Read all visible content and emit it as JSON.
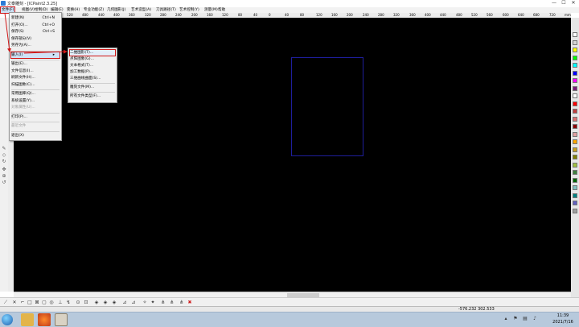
{
  "window": {
    "title": "文泰雕刻 - [ICPaint2.3.25]",
    "minimize": "—",
    "maximize": "☐",
    "close": "✕"
  },
  "menubar": [
    "文件(F)",
    "视图(V)",
    "绘制(D)",
    "编辑(E)",
    "变换(H)",
    "专业功能(Z)",
    "几何图形(J)",
    "艺术造型(A)",
    "刀具路径(T)",
    "艺术控制(Y)",
    "测量(M)",
    "帮助"
  ],
  "ruler": [
    "640",
    "600",
    "560",
    "520",
    "480",
    "440",
    "400",
    "360",
    "320",
    "280",
    "240",
    "200",
    "160",
    "120",
    "80",
    "40",
    "0",
    "40",
    "80",
    "120",
    "160",
    "200",
    "240",
    "280",
    "320",
    "360",
    "400",
    "440",
    "480",
    "520",
    "560",
    "600",
    "640",
    "680",
    "720",
    "mm"
  ],
  "file_menu": {
    "items": [
      {
        "label": "新建(N)",
        "shortcut": "Ctrl+N",
        "disabled": false
      },
      {
        "label": "打开(O)...",
        "shortcut": "Ctrl+O",
        "disabled": false
      },
      {
        "label": "保存(S)",
        "shortcut": "Ctrl+S",
        "disabled": false
      },
      {
        "label": "保存部分(V)",
        "shortcut": "",
        "disabled": false
      },
      {
        "label": "另存为(A)...",
        "shortcut": "",
        "disabled": false
      },
      {
        "label": "输入(I)",
        "shortcut": "",
        "disabled": false
      },
      {
        "label": "输出(E)...",
        "shortcut": "",
        "disabled": false
      },
      {
        "label": "文件信息(I)...",
        "shortcut": "",
        "disabled": false
      },
      {
        "label": "刷新文件(H)...",
        "shortcut": "",
        "disabled": false
      },
      {
        "label": "扫描图象(C)...",
        "shortcut": "",
        "disabled": false
      },
      {
        "label": "常用图库(Q)...",
        "shortcut": "",
        "disabled": false
      },
      {
        "label": "系统设置(Y)...",
        "shortcut": "",
        "disabled": false
      },
      {
        "label": "对象属性(U)...",
        "shortcut": "",
        "disabled": true
      },
      {
        "label": "打印(P)...",
        "shortcut": "",
        "disabled": false
      },
      {
        "label": "最近文件",
        "shortcut": "",
        "disabled": true
      },
      {
        "label": "退出(X)",
        "shortcut": "",
        "disabled": false
      }
    ]
  },
  "import_submenu": {
    "items": [
      "二维图形(T)...",
      "点阵图象(G)...",
      "文本格式(T)...",
      "加工数据(P)...",
      "三维曲线曲面(S)...",
      "雕刻文件(M)...",
      "所有文件类型(F)..."
    ]
  },
  "status": {
    "coords": "-576.232  302.533"
  },
  "taskbar": {
    "time": "11:39",
    "date": "2021/7/16"
  },
  "palette_colors": [
    "#ffffff",
    "#d4d4d4",
    "#ffff00",
    "#00ff00",
    "#00ffff",
    "#0000ff",
    "#ff00ff",
    "#7a1a7a",
    "#ffffff",
    "#ff0000",
    "#c04040",
    "#e07070",
    "#8b0000",
    "#e0a0a0",
    "#ffa500",
    "#c8a020",
    "#808000",
    "#a0c040",
    "#408040",
    "#006400",
    "#80c0c0",
    "#008080",
    "#6060c0",
    "#a0a0a0"
  ],
  "colors": {
    "canvas": "#000000",
    "artboard": "#1e1e9c",
    "highlight": "#d01818"
  }
}
